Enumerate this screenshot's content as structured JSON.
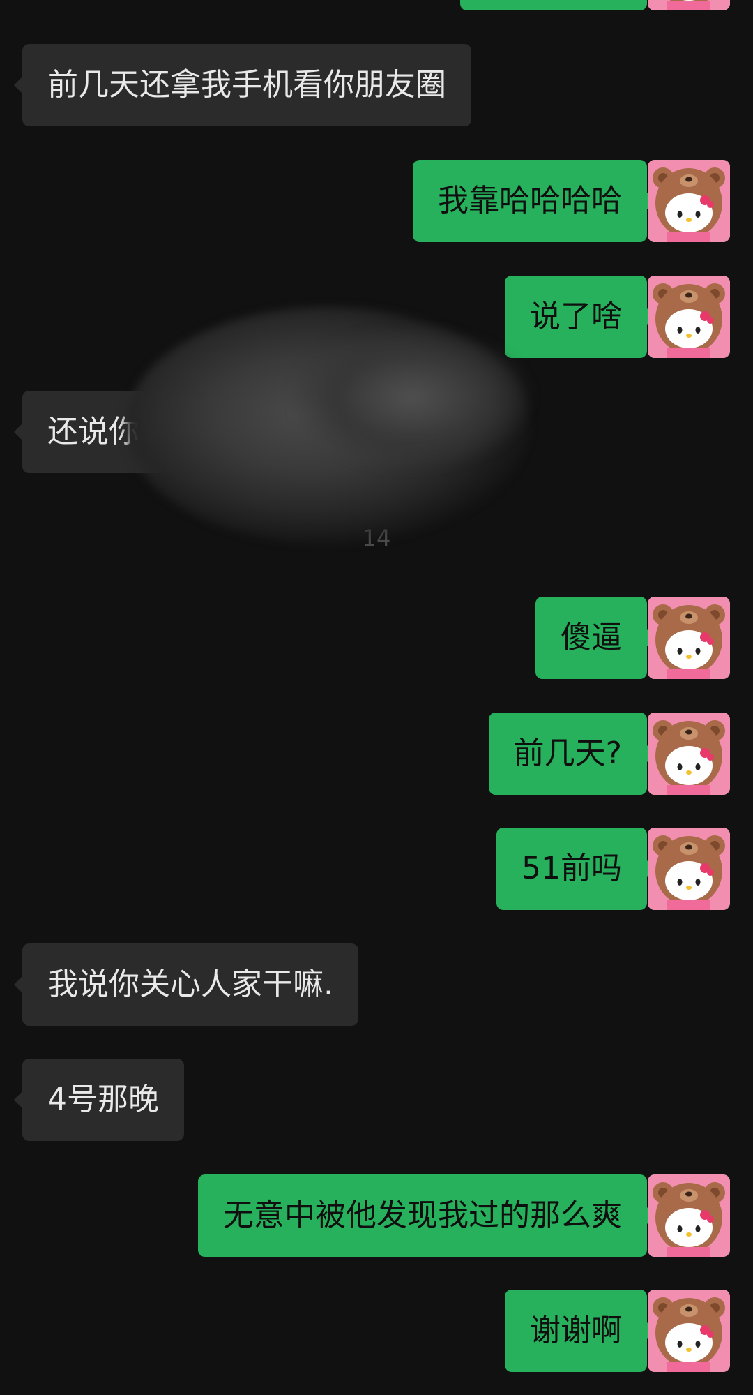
{
  "chat": {
    "timestamp": "14",
    "messages": [
      {
        "side": "out",
        "text": ""
      },
      {
        "side": "in",
        "text": "前几天还拿我手机看你朋友圈"
      },
      {
        "side": "out",
        "text": "我靠哈哈哈哈"
      },
      {
        "side": "out",
        "text": "说了啥"
      },
      {
        "side": "in",
        "text": "还说你"
      },
      {
        "side": "out",
        "text": "傻逼"
      },
      {
        "side": "out",
        "text": "前几天?"
      },
      {
        "side": "out",
        "text": "51前吗"
      },
      {
        "side": "in",
        "text": "我说你关心人家干嘛."
      },
      {
        "side": "in",
        "text": "4号那晚"
      },
      {
        "side": "out",
        "text": "无意中被他发现我过的那么爽"
      },
      {
        "side": "out",
        "text": "谢谢啊"
      }
    ],
    "avatar_icon": "bear-hood-kitty-avatar",
    "colors": {
      "background": "#111111",
      "incoming_bubble": "#2b2b2b",
      "outgoing_bubble": "#27b15c",
      "avatar_background": "#f28fb0"
    }
  }
}
